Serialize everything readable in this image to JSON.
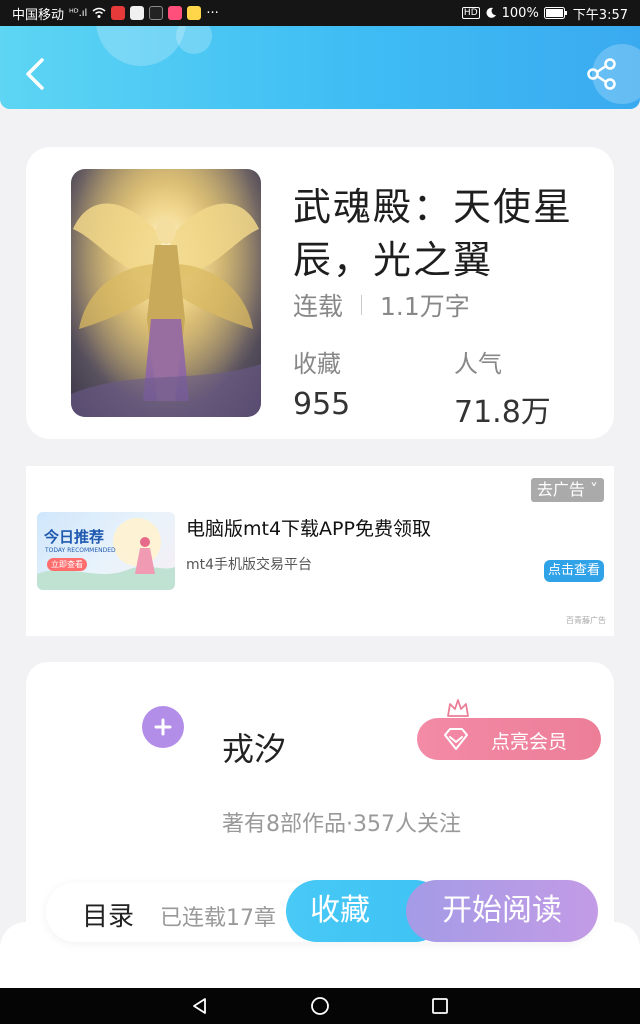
{
  "status_bar": {
    "carrier": "中国移动",
    "signal": "ᴴᴰ.ıl",
    "more": "···",
    "hd": "HD",
    "battery": "100%",
    "time": "下午3:57"
  },
  "header": {
    "back_icon": "chevron-left-icon",
    "share_icon": "share-icon",
    "gradient": [
      "#5dd5f3",
      "#3aaaf0"
    ]
  },
  "book": {
    "title": "武魂殿：天使星辰，光之翼",
    "status": "连载",
    "word_count": "1.1万字",
    "favorites_label": "收藏",
    "favorites_value": "955",
    "popularity_label": "人气",
    "popularity_value": "71.8万"
  },
  "ad": {
    "close_label": "去广告 ˅",
    "image_title": "今日推荐",
    "image_subtitle": "TODAY RECOMMENDED",
    "image_button": "立即查看",
    "title": "电脑版mt4下载APP免费领取",
    "description": "mt4手机版交易平台",
    "cta": "点击查看",
    "source": "百青藤广告"
  },
  "author": {
    "name": "戎汐",
    "stats": "著有8部作品·357人关注",
    "vip_label": "点亮会员",
    "follow_icon": "plus-icon",
    "vip_color": "#ec7e98"
  },
  "bottom_bar": {
    "toc_label": "目录",
    "toc_status": "已连载17章",
    "collect_label": "收藏",
    "read_label": "开始阅读",
    "collect_color": "#3ec2f4",
    "read_color": "#b59be6"
  },
  "nav_bar": {
    "icons": [
      "back-triangle-icon",
      "home-circle-icon",
      "recents-square-icon"
    ]
  }
}
